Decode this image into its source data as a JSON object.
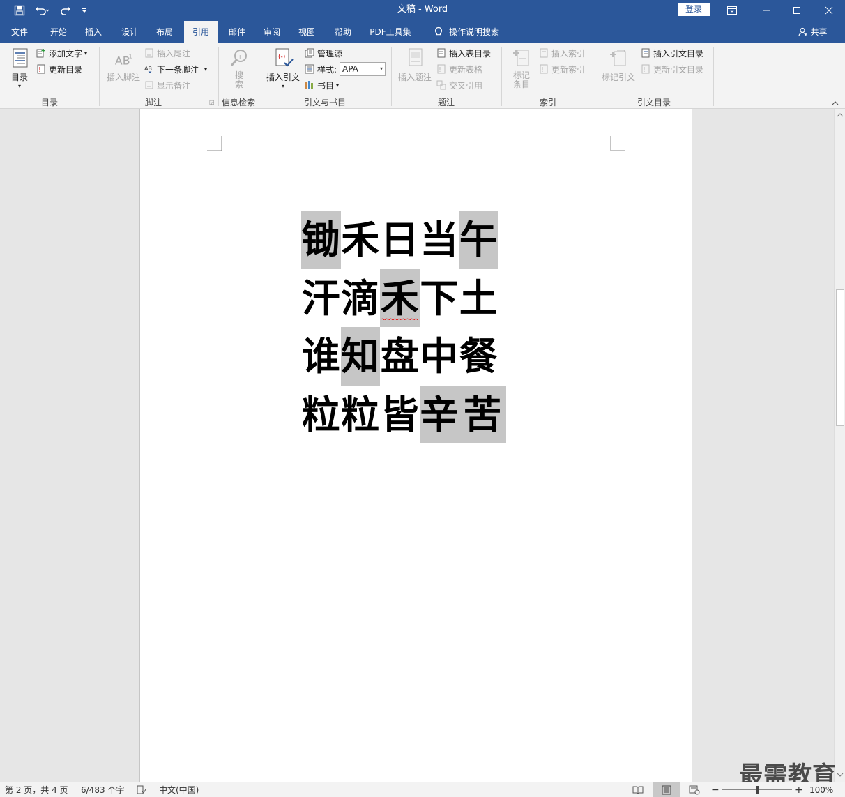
{
  "window": {
    "title": "文稿  -  Word",
    "login_label": "登录"
  },
  "tabs": [
    {
      "label": "文件"
    },
    {
      "label": "开始"
    },
    {
      "label": "插入"
    },
    {
      "label": "设计"
    },
    {
      "label": "布局"
    },
    {
      "label": "引用"
    },
    {
      "label": "邮件"
    },
    {
      "label": "审阅"
    },
    {
      "label": "视图"
    },
    {
      "label": "帮助"
    },
    {
      "label": "PDF工具集"
    }
  ],
  "tell_me": "操作说明搜索",
  "share_label": "共享",
  "ribbon": {
    "toc": {
      "big_label": "目录",
      "add_text": "添加文字",
      "update_toc": "更新目录",
      "group_label": "目录"
    },
    "footnotes": {
      "insert_footnote": "插入脚注",
      "insert_endnote": "插入尾注",
      "next_footnote": "下一条脚注",
      "show_notes": "显示备注",
      "group_label": "脚注"
    },
    "research": {
      "search": "搜索",
      "group_label": "信息检索"
    },
    "citations": {
      "insert_citation": "插入引文",
      "manage_sources": "管理源",
      "style_label": "样式:",
      "style_value": "APA",
      "bibliography": "书目",
      "group_label": "引文与书目"
    },
    "captions": {
      "insert_caption": "插入题注",
      "insert_table_of_figures": "插入表目录",
      "update_table": "更新表格",
      "cross_reference": "交叉引用",
      "group_label": "题注"
    },
    "index": {
      "mark_entry": "标记条目",
      "insert_index": "插入索引",
      "update_index": "更新索引",
      "group_label": "索引"
    },
    "toa": {
      "mark_citation": "标记引文",
      "insert_toa": "插入引文目录",
      "update_toa": "更新引文目录",
      "group_label": "引文目录"
    }
  },
  "document": {
    "lines": [
      [
        {
          "c": "锄",
          "hl": true
        },
        {
          "c": "禾",
          "hl": false
        },
        {
          "c": "日",
          "hl": false
        },
        {
          "c": "当",
          "hl": false
        },
        {
          "c": "午",
          "hl": true
        }
      ],
      [
        {
          "c": "汗",
          "hl": false
        },
        {
          "c": "滴",
          "hl": false
        },
        {
          "c": "禾",
          "hl": true,
          "squiggle": true
        },
        {
          "c": "下",
          "hl": false
        },
        {
          "c": "土",
          "hl": false
        }
      ],
      [
        {
          "c": "谁",
          "hl": false
        },
        {
          "c": "知",
          "hl": true
        },
        {
          "c": "盘",
          "hl": false
        },
        {
          "c": "中",
          "hl": false
        },
        {
          "c": "餐",
          "hl": false
        }
      ],
      [
        {
          "c": "粒",
          "hl": false
        },
        {
          "c": "粒",
          "hl": false
        },
        {
          "c": "皆",
          "hl": false
        },
        {
          "c": "辛",
          "hl": true
        },
        {
          "c": "苦",
          "hl": true
        }
      ]
    ]
  },
  "status": {
    "page": "第 2 页，共 4 页",
    "words": "6/483 个字",
    "language": "中文(中国)",
    "zoom": "100%",
    "zoom_level": 100
  },
  "watermark": "最需教育",
  "colors": {
    "accent": "#2b579a",
    "highlight": "#c6c6c6",
    "ribbon_bg": "#f3f3f3"
  }
}
